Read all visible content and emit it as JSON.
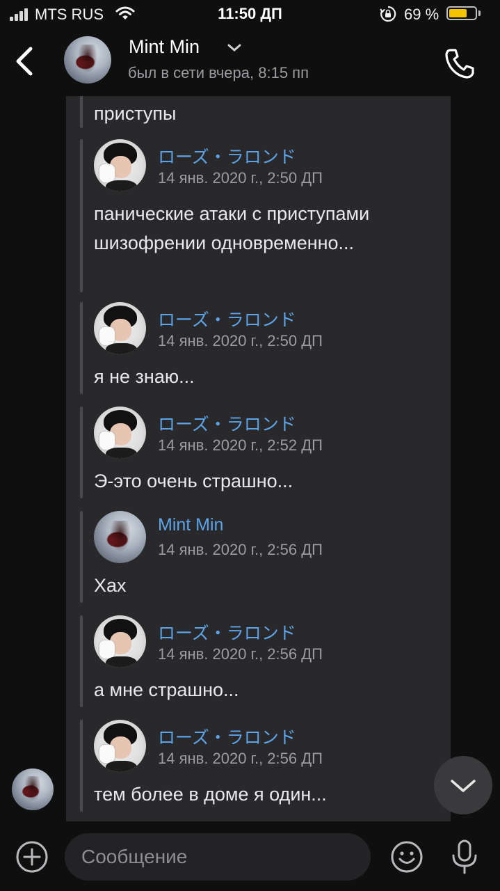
{
  "status_bar": {
    "carrier": "MTS RUS",
    "time": "11:50 ДП",
    "battery_percent_label": "69 %",
    "battery_level": 0.69,
    "icons": [
      "signal-icon",
      "wifi-icon",
      "rotation-lock-icon",
      "battery-icon"
    ]
  },
  "header": {
    "contact_name": "Mint Min",
    "last_seen": "был в сети вчера, 8:15 пп",
    "icons": [
      "back-chevron-icon",
      "chevron-down-icon",
      "phone-icon"
    ]
  },
  "forwarded": {
    "partial_text": "приступы",
    "messages": [
      {
        "author": "ローズ・ラロンド",
        "date": "14 янв. 2020 г., 2:50 ДП",
        "text": "панические атаки с приступами шизофрении одновременно..."
      },
      {
        "author": "ローズ・ラロンド",
        "date": "14 янв. 2020 г., 2:50 ДП",
        "text": "я не знаю..."
      },
      {
        "author": "ローズ・ラロンド",
        "date": "14 янв. 2020 г., 2:52 ДП",
        "text": "Э-это очень страшно..."
      },
      {
        "author": "Mint Min",
        "date": "14 янв. 2020 г., 2:56 ДП",
        "text": "Хах"
      },
      {
        "author": "ローズ・ラロンド",
        "date": "14 янв. 2020 г., 2:56 ДП",
        "text": "а мне страшно..."
      },
      {
        "author": "ローズ・ラロンド",
        "date": "14 янв. 2020 г., 2:56 ДП",
        "text": "тем более в доме я один..."
      }
    ]
  },
  "composer": {
    "placeholder": "Сообщение",
    "icons": [
      "plus-circle-icon",
      "smiley-icon",
      "microphone-icon",
      "chevron-down-icon"
    ]
  },
  "colors": {
    "background": "#0f0f10",
    "card": "#29292c",
    "author_link": "#5da3e8",
    "battery": "#f5c400"
  }
}
